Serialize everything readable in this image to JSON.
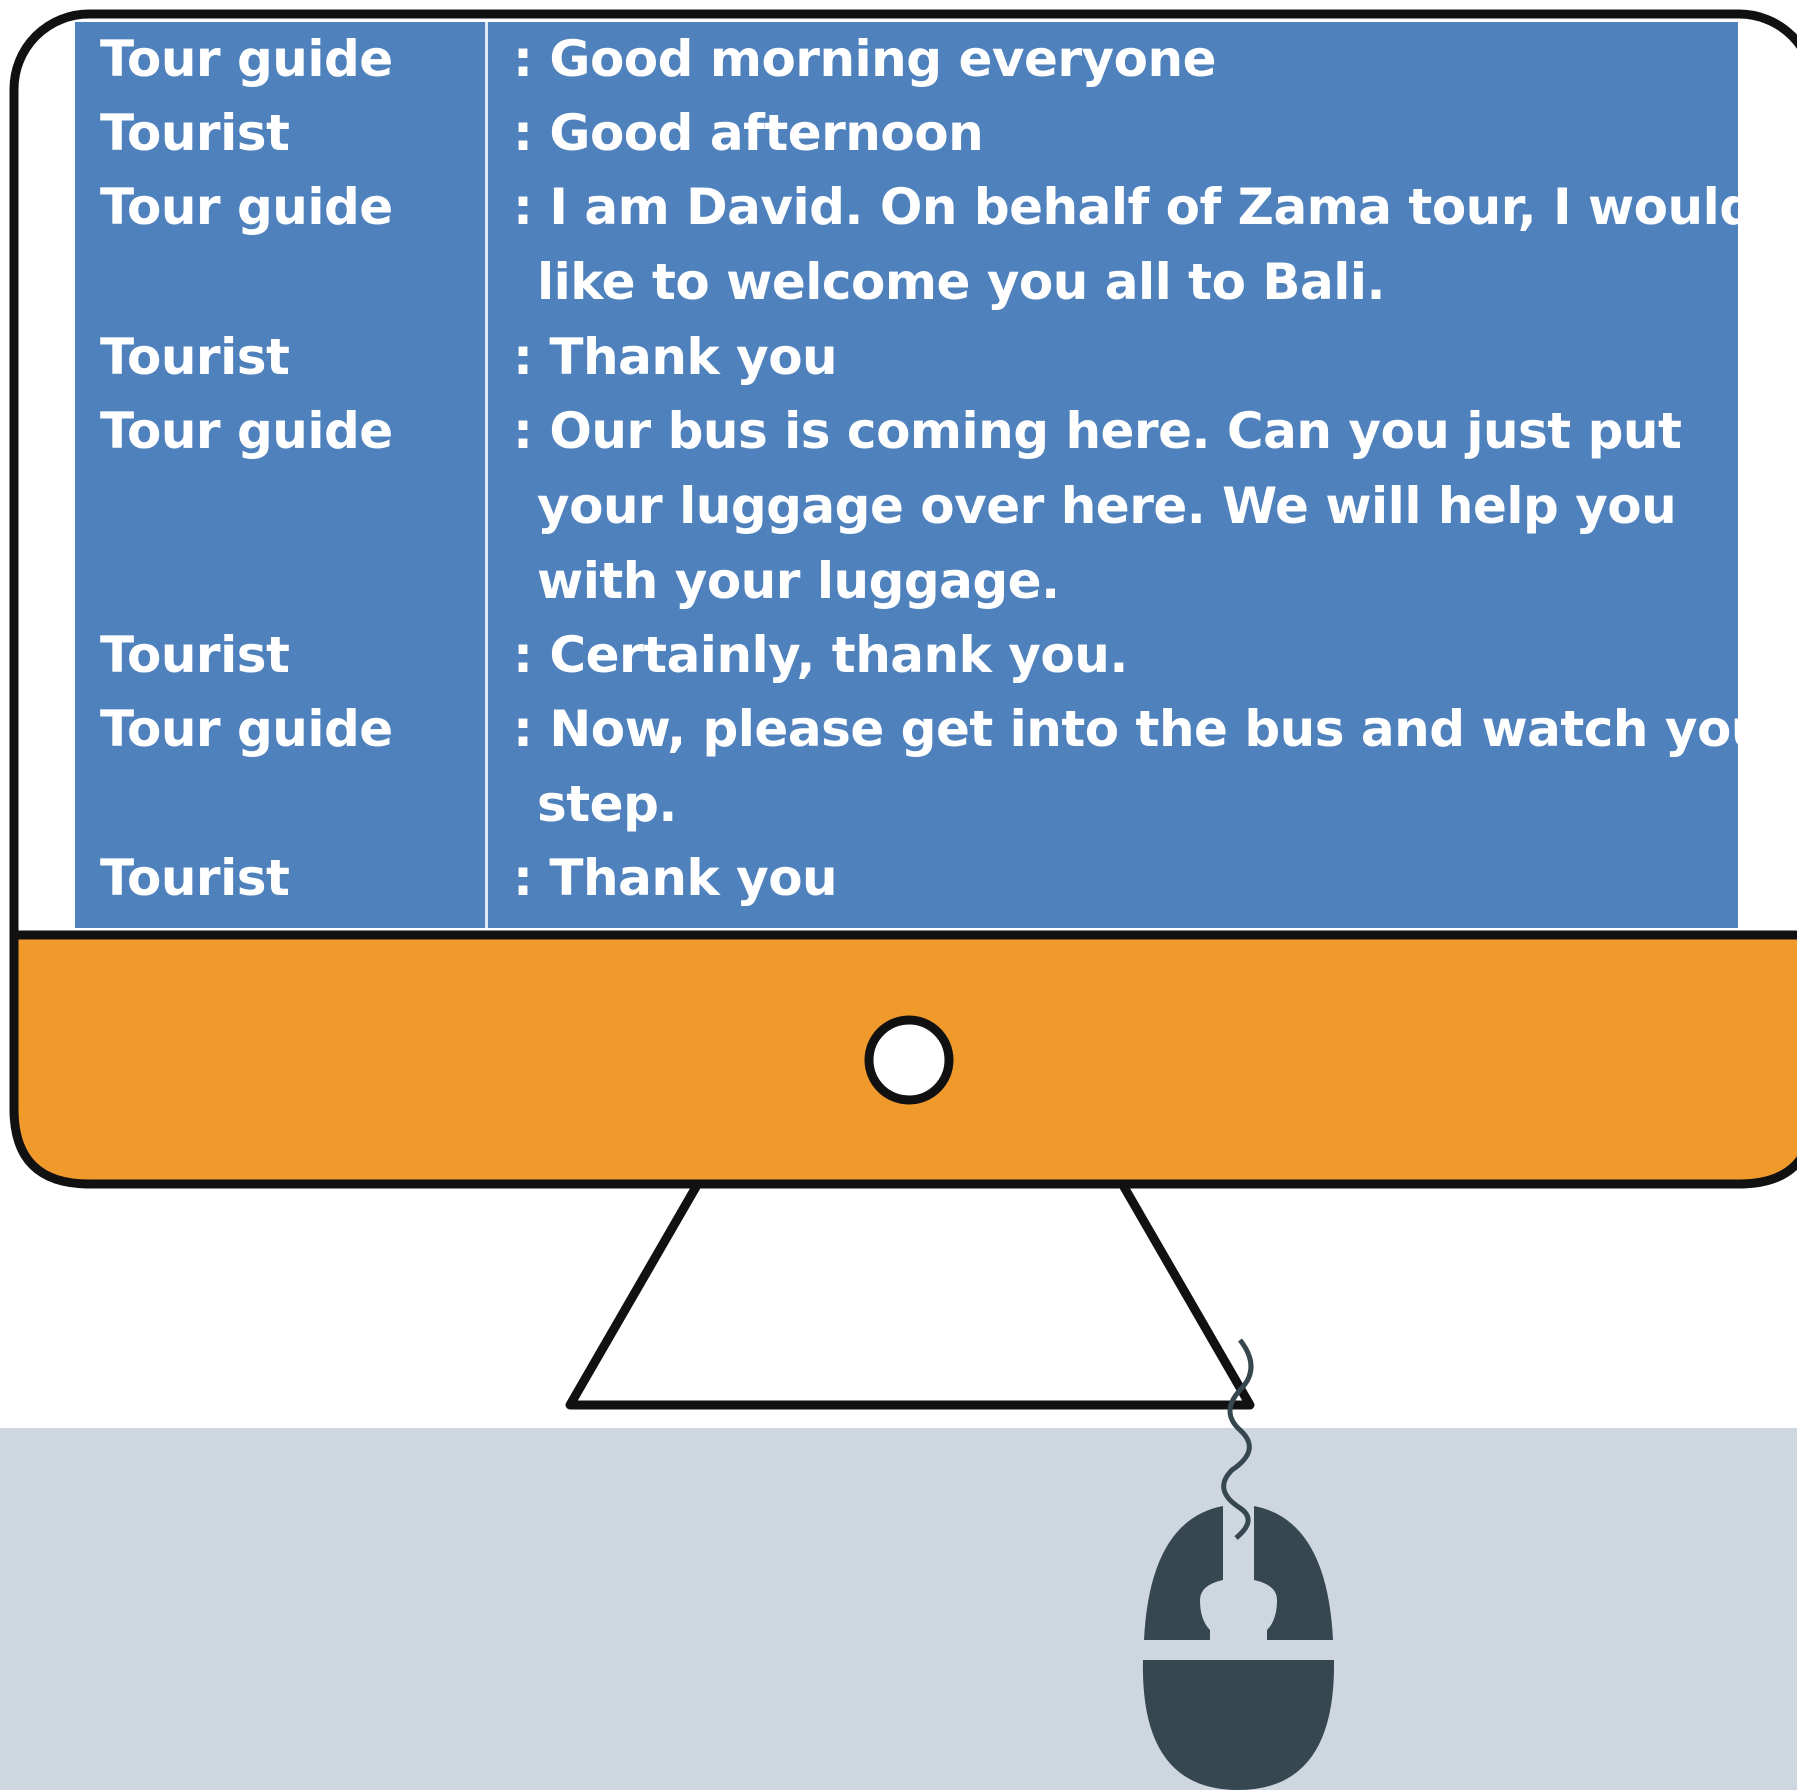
{
  "dialogue": [
    {
      "speaker": "Tour guide",
      "lines": [
        ": Good morning everyone"
      ]
    },
    {
      "speaker": "Tourist",
      "lines": [
        ": Good afternoon"
      ]
    },
    {
      "speaker": "Tour guide",
      "lines": [
        ": I am David. On behalf of Zama tour, I would",
        "like to welcome you all to Bali."
      ]
    },
    {
      "speaker": "Tourist",
      "lines": [
        ": Thank you"
      ]
    },
    {
      "speaker": "Tour guide",
      "lines": [
        ": Our bus is coming here. Can you just put",
        "your luggage over here. We will help you",
        "with your luggage."
      ]
    },
    {
      "speaker": "Tourist",
      "lines": [
        ": Certainly, thank you."
      ]
    },
    {
      "speaker": "Tour guide",
      "lines": [
        ": Now, please get into the bus and watch your",
        "step."
      ]
    },
    {
      "speaker": "Tourist",
      "lines": [
        ": Thank you"
      ]
    }
  ],
  "colors": {
    "screen": "#4f81bd",
    "bezel": "#f09a2c",
    "outline": "#111111",
    "desk": "#ced7df",
    "mouse": "#37474f"
  },
  "icons": [
    "monitor-icon",
    "power-button-icon",
    "mouse-icon"
  ]
}
